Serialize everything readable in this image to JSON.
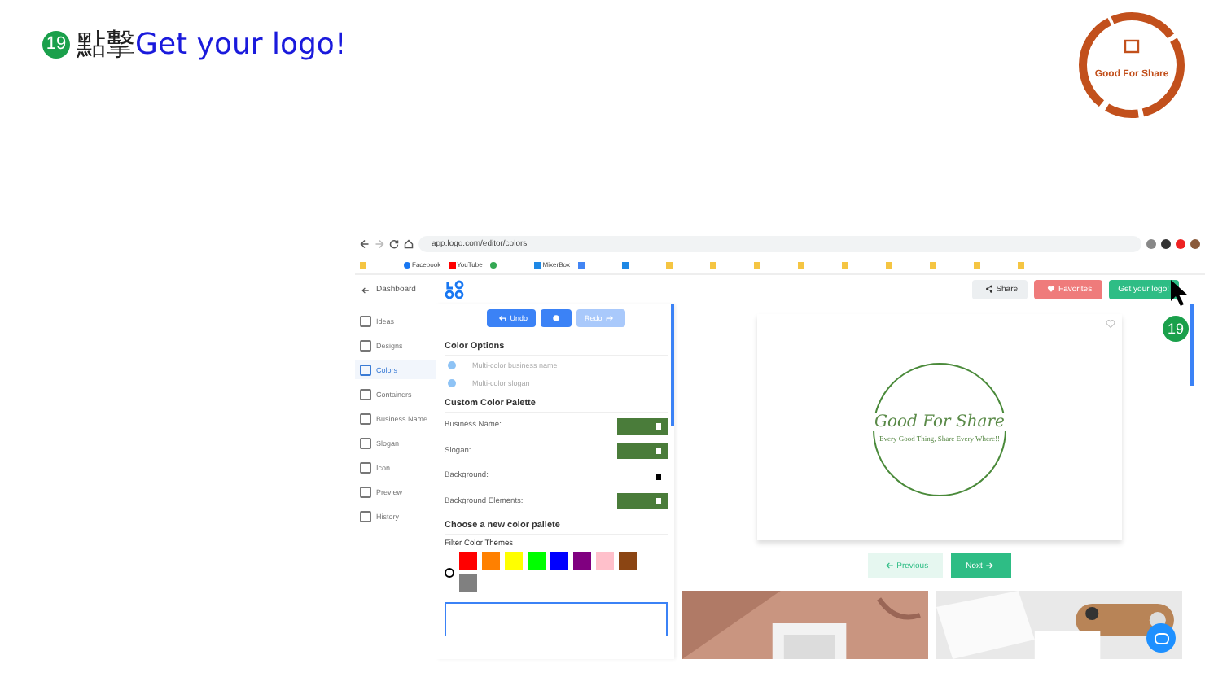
{
  "slide": {
    "step": "19",
    "title": "點擊",
    "title_highlight": "Get your logo!"
  },
  "brand_logo": {
    "name": "Good For Share"
  },
  "browser": {
    "url": "app.logo.com/editor/colors",
    "bookmarks": [
      {
        "kind": "folder"
      },
      {
        "label": "Facebook",
        "kind": "facebook"
      },
      {
        "label": "YouTube",
        "kind": "youtube"
      },
      {
        "kind": "maps"
      },
      {
        "label": "MixerBox",
        "kind": "site"
      },
      {
        "kind": "translate"
      },
      {
        "kind": "site"
      },
      {
        "kind": "folder"
      },
      {
        "kind": "folder"
      },
      {
        "kind": "folder"
      },
      {
        "kind": "folder"
      },
      {
        "kind": "folder"
      },
      {
        "kind": "folder"
      },
      {
        "kind": "folder"
      },
      {
        "kind": "folder"
      },
      {
        "kind": "folder"
      }
    ]
  },
  "app": {
    "back": "Dashboard",
    "header_buttons": [
      {
        "label": "Share",
        "kind": "share"
      },
      {
        "label": "Favorites",
        "kind": "favorite"
      },
      {
        "label": "Get your logo!",
        "kind": "primary"
      }
    ],
    "sidebar": [
      {
        "label": "Ideas",
        "selected": false
      },
      {
        "label": "Designs",
        "selected": false
      },
      {
        "label": "Colors",
        "selected": true
      },
      {
        "label": "Containers",
        "selected": false
      },
      {
        "label": "Business Name",
        "selected": false
      },
      {
        "label": "Slogan",
        "selected": false
      },
      {
        "label": "Icon",
        "selected": false
      },
      {
        "label": "Preview",
        "selected": false
      },
      {
        "label": "History",
        "selected": false
      }
    ],
    "toolbar": [
      {
        "label": "Undo",
        "kind": "undo",
        "disabled": false
      },
      {
        "kind": "info",
        "disabled": false
      },
      {
        "label": "Redo",
        "kind": "redo",
        "disabled": true
      }
    ],
    "color_options_title": "Color Options",
    "color_options": [
      {
        "label": "Multi-color business name"
      },
      {
        "label": "Multi-color slogan"
      }
    ],
    "palette_title": "Custom Color Palette",
    "palette": [
      {
        "label": "Business Name:",
        "color": "#4a7c3a"
      },
      {
        "label": "Slogan:",
        "color": "#4a7c3a"
      },
      {
        "label": "Background:",
        "color": "#ffffff"
      },
      {
        "label": "Background Elements:",
        "color": "#4a7c3a"
      }
    ],
    "new_palette_title": "Choose a new color pallete",
    "filter_title": "Filter Color Themes",
    "swatches": [
      {
        "color": "#ff0000"
      },
      {
        "color": "#ff8000"
      },
      {
        "color": "#ffff00"
      },
      {
        "color": "#00ff00"
      },
      {
        "color": "#0000ff"
      },
      {
        "color": "#800080"
      },
      {
        "color": "#ffc0cb"
      },
      {
        "color": "#8b4513"
      },
      {
        "color": "#808080"
      }
    ],
    "preview": {
      "name": "Good For Share",
      "slogan": "Every Good Thing, Share Every Where!!"
    },
    "nav": [
      {
        "label": "Previous",
        "kind": "previous"
      },
      {
        "label": "Next",
        "kind": "next"
      }
    ]
  },
  "callout": {
    "step": "19"
  }
}
